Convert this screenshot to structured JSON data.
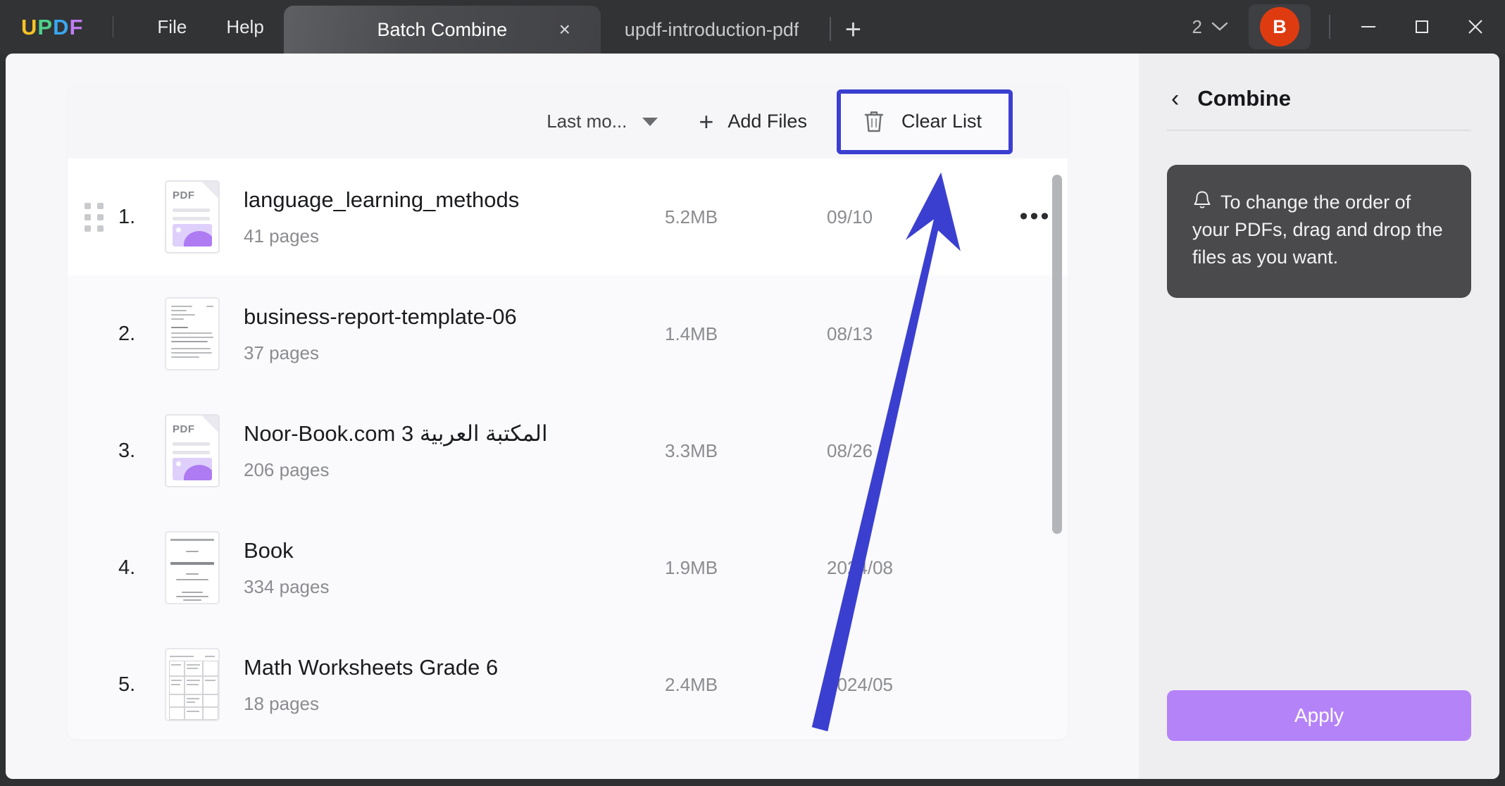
{
  "titlebar": {
    "logo_letters": [
      {
        "char": "U",
        "color": "#f7c325"
      },
      {
        "char": "P",
        "color": "#4fd18b"
      },
      {
        "char": "D",
        "color": "#3aa7f0"
      },
      {
        "char": "F",
        "color": "#c07df5"
      }
    ],
    "menus": [
      "File",
      "Help"
    ],
    "tabs": [
      {
        "label": "Batch Combine",
        "active": true,
        "close": "×"
      },
      {
        "label": "updf-introduction-pdf",
        "active": false
      }
    ],
    "new_tab_label": "+",
    "tab_count": "2",
    "avatar_initial": "B",
    "window_buttons": {
      "minimize": "minimize-icon",
      "maximize": "maximize-icon",
      "close": "close-icon"
    }
  },
  "toolbar": {
    "sort_label": "Last mo...",
    "add_files_label": "Add Files",
    "add_files_plus": "+",
    "clear_list_label": "Clear List",
    "highlight_color": "#3b3fd0"
  },
  "files": [
    {
      "index": "1.",
      "name": "language_learning_methods",
      "pages": "41 pages",
      "size": "5.2MB",
      "date": "09/10",
      "thumb": "pdf",
      "pdf_tag": "PDF",
      "hovered": true
    },
    {
      "index": "2.",
      "name": "business-report-template-06",
      "pages": "37 pages",
      "size": "1.4MB",
      "date": "08/13",
      "thumb": "doc",
      "hovered": false
    },
    {
      "index": "3.",
      "name": "Noor-Book.com  3 المكتبة العربية",
      "pages": "206 pages",
      "size": "3.3MB",
      "date": "08/26",
      "thumb": "pdf",
      "pdf_tag": "PDF",
      "hovered": false
    },
    {
      "index": "4.",
      "name": "Book",
      "pages": "334 pages",
      "size": "1.9MB",
      "date": "2024/08",
      "thumb": "title",
      "hovered": false
    },
    {
      "index": "5.",
      "name": "Math Worksheets Grade 6",
      "pages": "18 pages",
      "size": "2.4MB",
      "date": "2024/05",
      "thumb": "grid",
      "hovered": false
    }
  ],
  "row_more_glyph": "•••",
  "right_panel": {
    "back_glyph": "‹",
    "title": "Combine",
    "tip_text": "To change the order of your PDFs, drag and drop the files as you want.",
    "apply_label": "Apply",
    "apply_color": "#b583f8"
  },
  "annotation": {
    "arrow_color": "#3b3fd0",
    "target": "clear-list-button"
  }
}
